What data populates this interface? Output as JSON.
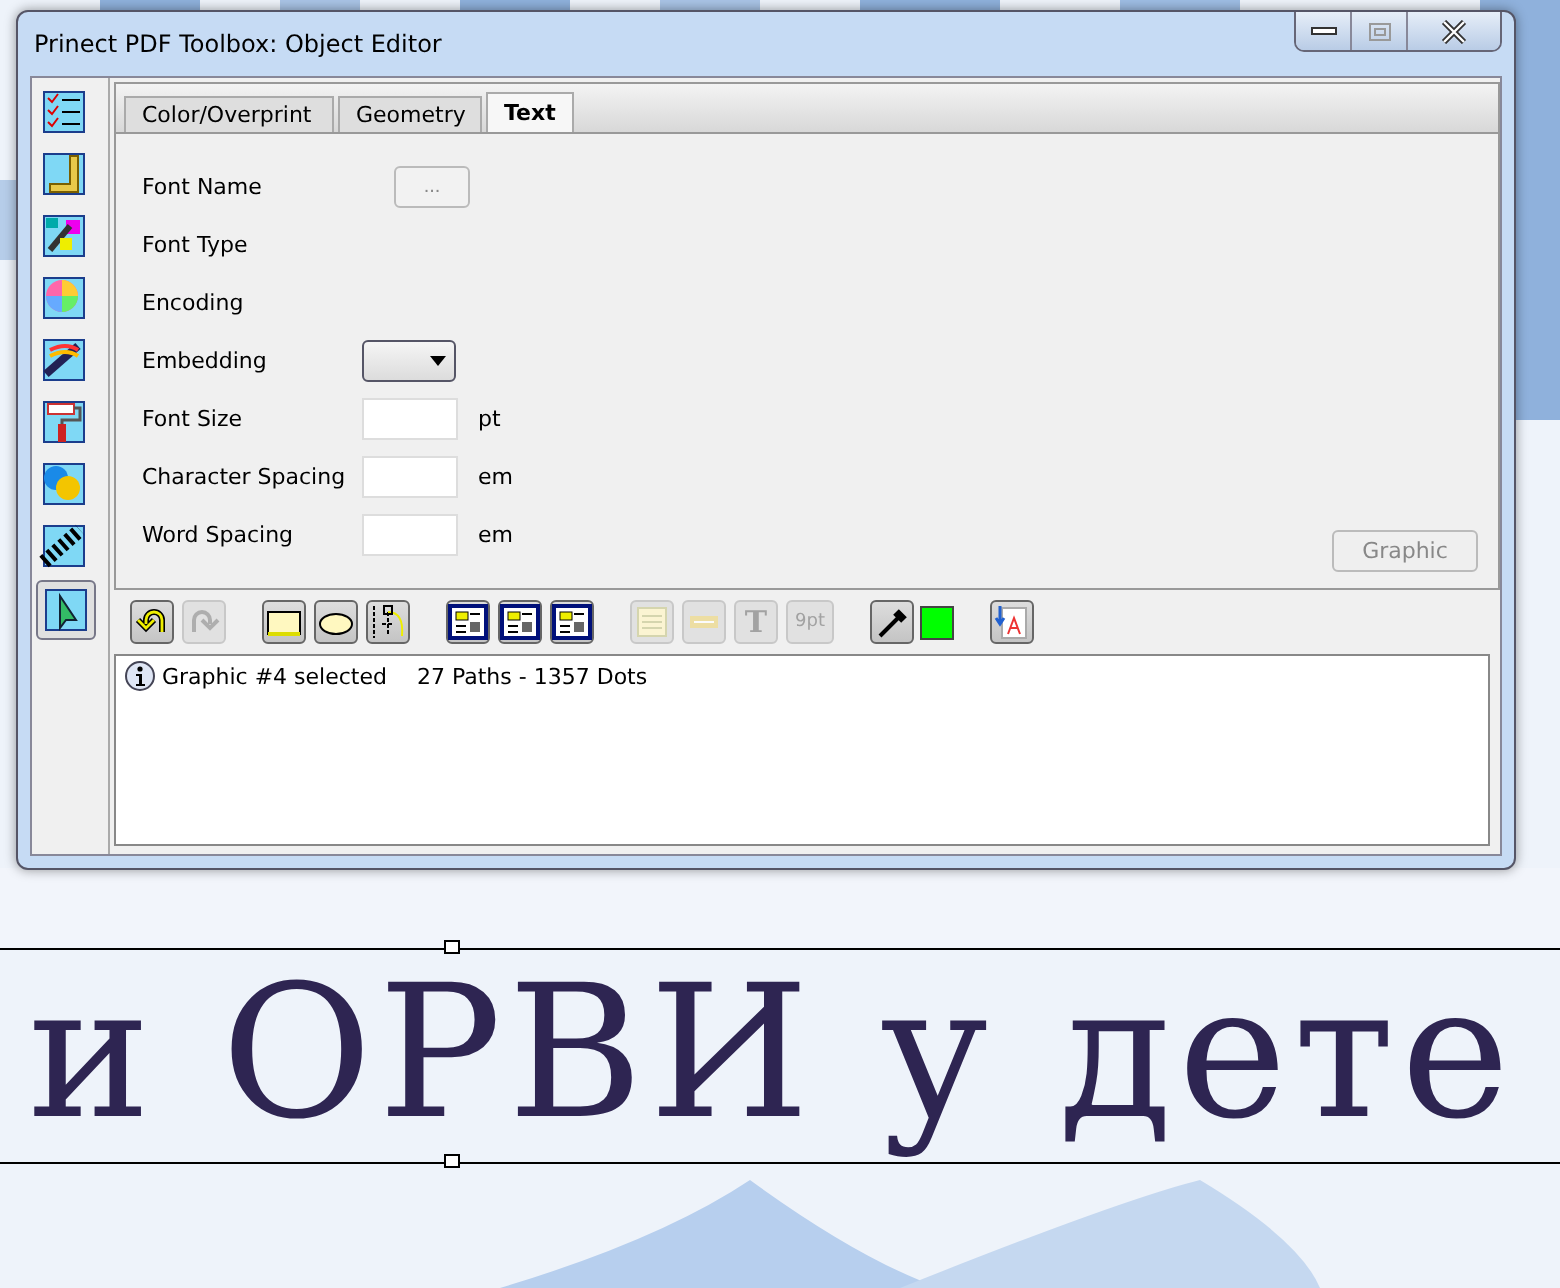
{
  "window": {
    "title": "Prinect PDF Toolbox: Object Editor"
  },
  "sidebar": {
    "items": [
      {
        "kind": "checklist",
        "selected": false
      },
      {
        "kind": "ruler",
        "selected": false
      },
      {
        "kind": "separations",
        "selected": false
      },
      {
        "kind": "colorwheel",
        "selected": false
      },
      {
        "kind": "swatches",
        "selected": false
      },
      {
        "kind": "roller",
        "selected": false
      },
      {
        "kind": "overlap",
        "selected": false
      },
      {
        "kind": "checker",
        "selected": false
      },
      {
        "kind": "pointer",
        "selected": true
      }
    ]
  },
  "tabs": [
    {
      "label": "Color/Overprint",
      "selected": false
    },
    {
      "label": "Geometry",
      "selected": false
    },
    {
      "label": "Text",
      "selected": true
    }
  ],
  "form": [
    {
      "label": "Font Name",
      "kind": "button",
      "value": "..."
    },
    {
      "label": "Font Type",
      "kind": "none"
    },
    {
      "label": "Encoding",
      "kind": "none"
    },
    {
      "label": "Embedding",
      "kind": "dropdown"
    },
    {
      "label": "Font Size",
      "kind": "input",
      "unit": "pt"
    },
    {
      "label": "Character Spacing",
      "kind": "input",
      "unit": "em"
    },
    {
      "label": "Word Spacing",
      "kind": "input",
      "unit": "em"
    }
  ],
  "graphic_button": {
    "label": "Graphic",
    "disabled": true
  },
  "toolbar": [
    {
      "kind": "undo",
      "disabled": false
    },
    {
      "kind": "redo",
      "disabled": true
    },
    {
      "kind": "gap"
    },
    {
      "kind": "rect",
      "disabled": false
    },
    {
      "kind": "ellipse",
      "disabled": false
    },
    {
      "kind": "path",
      "disabled": false
    },
    {
      "kind": "gap"
    },
    {
      "kind": "layout1",
      "disabled": false
    },
    {
      "kind": "layout2",
      "disabled": false
    },
    {
      "kind": "layout3",
      "disabled": false
    },
    {
      "kind": "gap"
    },
    {
      "kind": "lines",
      "disabled": true
    },
    {
      "kind": "line",
      "disabled": true
    },
    {
      "kind": "glyph",
      "label": "T",
      "disabled": true
    },
    {
      "kind": "glyph",
      "label": "9pt",
      "disabled": true
    },
    {
      "kind": "gap"
    },
    {
      "kind": "eyedropper",
      "disabled": false
    },
    {
      "kind": "swatch",
      "color": "#00ff00"
    },
    {
      "kind": "gap"
    },
    {
      "kind": "pdf",
      "disabled": false
    }
  ],
  "log": [
    {
      "message": "Graphic #4 selected",
      "detail": "27 Paths - 1357 Dots"
    }
  ],
  "document": {
    "text": "и ОРВИ у дете"
  }
}
